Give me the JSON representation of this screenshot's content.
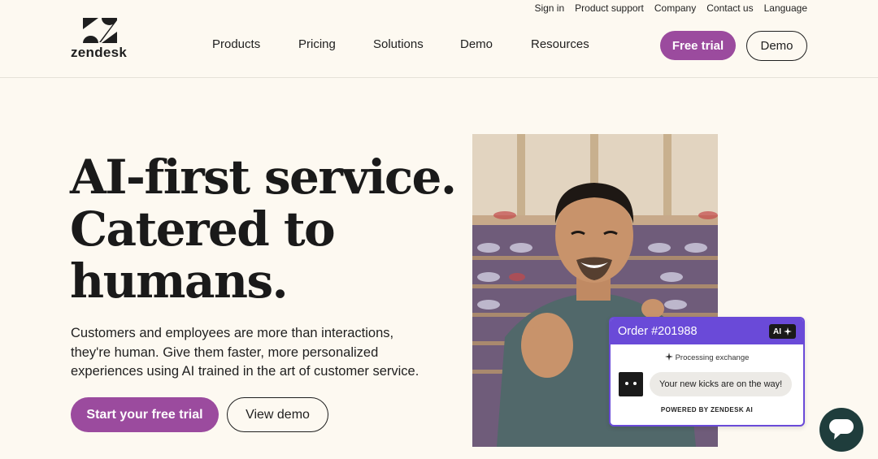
{
  "utility_nav": [
    "Sign in",
    "Product support",
    "Company",
    "Contact us",
    "Language"
  ],
  "brand": {
    "name": "zendesk"
  },
  "main_nav": {
    "products": "Products",
    "pricing": "Pricing",
    "solutions": "Solutions",
    "demo": "Demo",
    "resources": "Resources"
  },
  "header_buttons": {
    "free_trial": "Free trial",
    "demo": "Demo"
  },
  "hero": {
    "headline": [
      "AI-first service.",
      "Catered to",
      "humans."
    ],
    "subcopy": [
      "Customers and employees are more than interactions,",
      "they're human. Give them faster, more personalized",
      "experiences using AI trained in the art of customer service."
    ],
    "primary_cta": "Start your free trial",
    "secondary_cta": "View demo"
  },
  "order_card": {
    "title": "Order #201988",
    "ai_badge": "AI",
    "status": "Processing exchange",
    "message": "Your new kicks are on the way!",
    "footer": "POWERED BY ZENDESK AI"
  },
  "colors": {
    "background": "#fdf9f1",
    "accent": "#9b4b9e",
    "card_accent": "#6a4ad8",
    "chat_widget": "#1f3d3c"
  },
  "icons": [
    "zendesk-logo-icon",
    "sparkle-icon",
    "bot-avatar-icon",
    "chat-bubble-icon"
  ]
}
